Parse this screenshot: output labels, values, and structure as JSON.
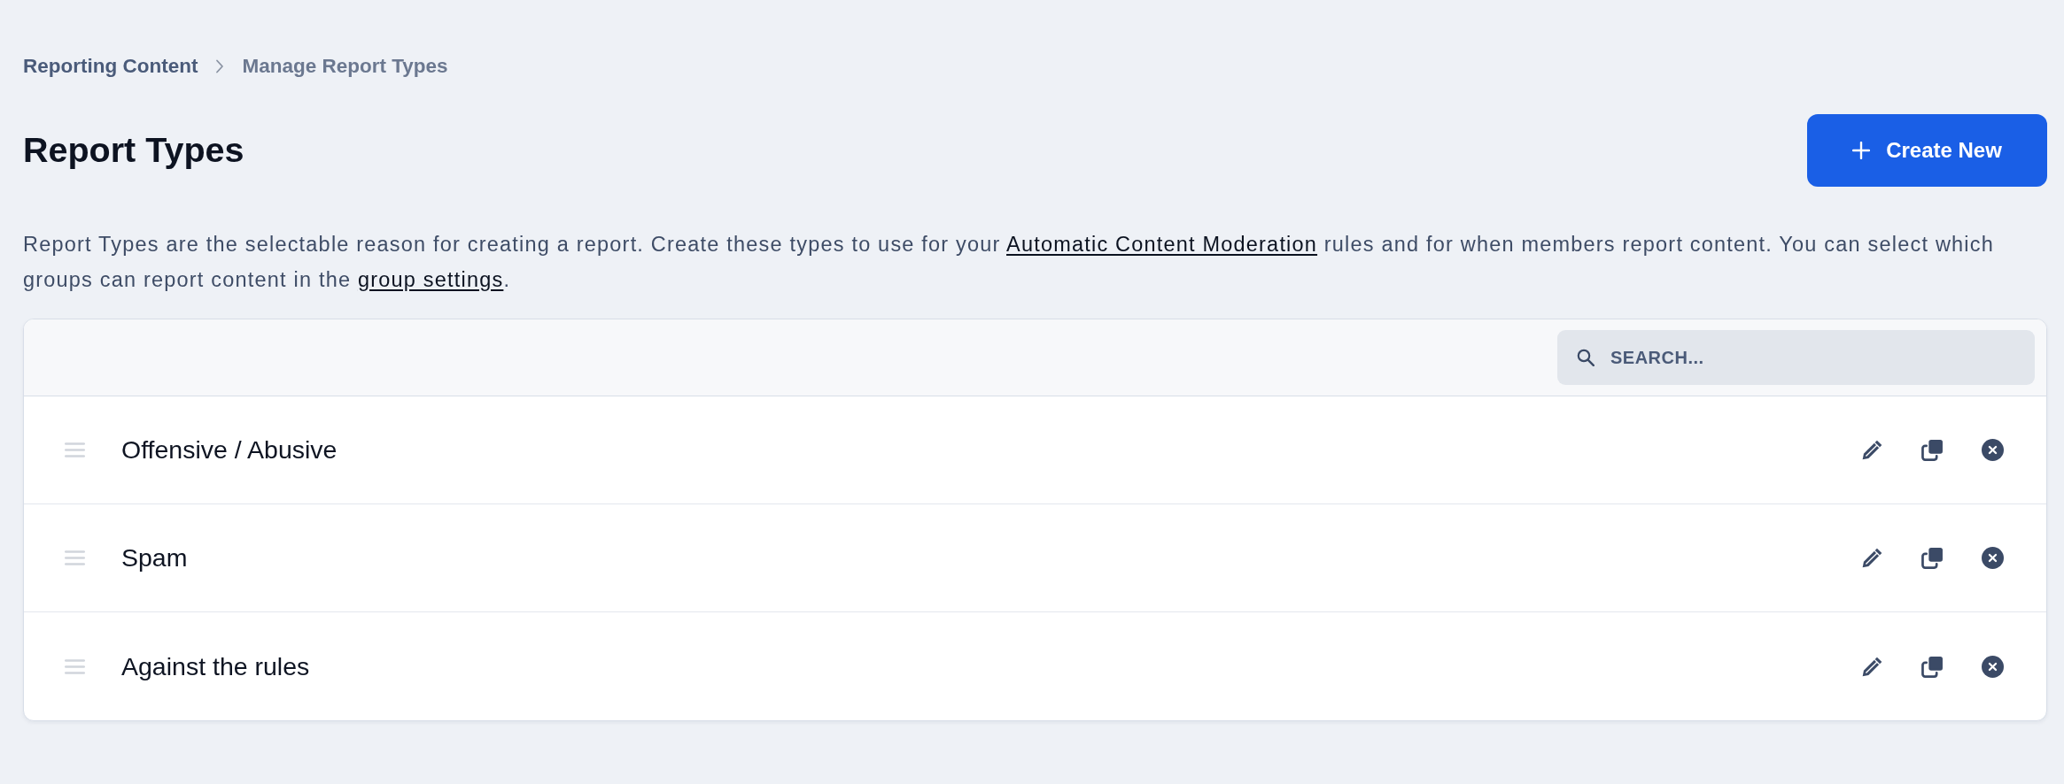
{
  "breadcrumb": [
    {
      "label": "Reporting Content",
      "current": false
    },
    {
      "label": "Manage Report Types",
      "current": true
    }
  ],
  "title": "Report Types",
  "create_button": {
    "label": "Create New"
  },
  "description": [
    {
      "kind": "text",
      "text": "Report Types are the selectable reason for creating a report. Create these types to use for your "
    },
    {
      "kind": "link",
      "text": "Automatic Content Moderation"
    },
    {
      "kind": "text",
      "text": " rules and for when members report content. You can select which groups can report content in the "
    },
    {
      "kind": "link",
      "text": "group settings"
    },
    {
      "kind": "text",
      "text": "."
    }
  ],
  "search": {
    "placeholder": "SEARCH..."
  },
  "report_types": [
    {
      "name": "Offensive / Abusive"
    },
    {
      "name": "Spam"
    },
    {
      "name": "Against the rules"
    }
  ]
}
